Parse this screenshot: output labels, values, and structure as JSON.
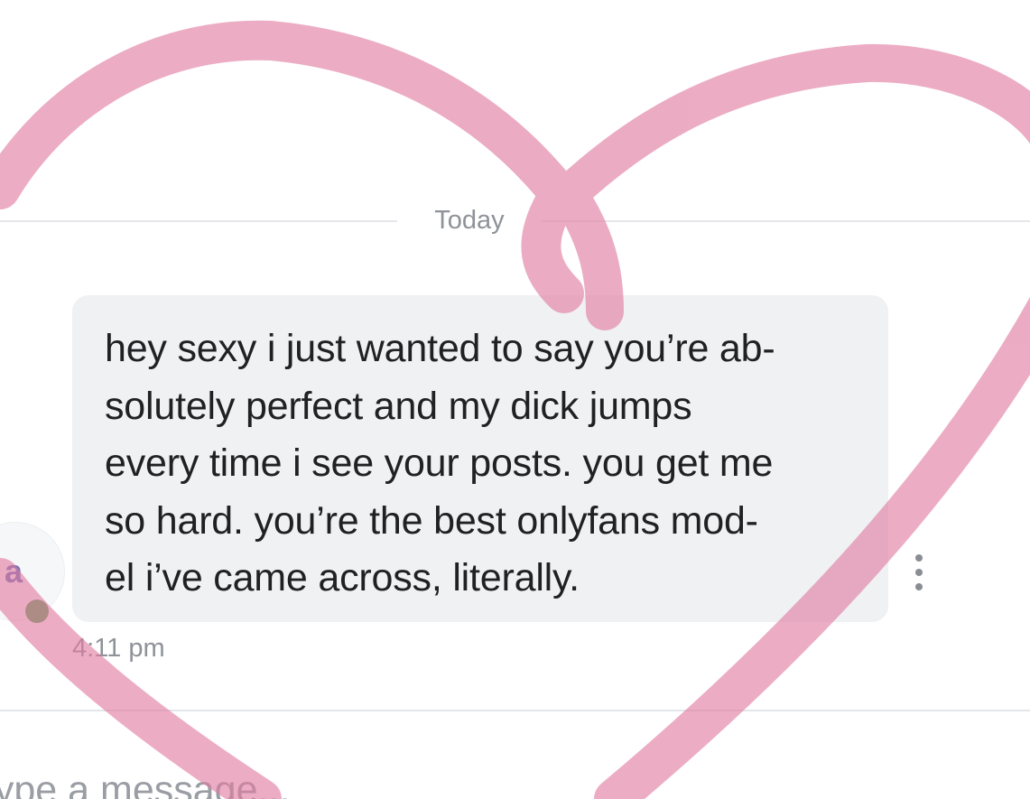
{
  "chat": {
    "date_divider": "Today",
    "avatar_initial": "a",
    "message": {
      "text": "hey sexy i just wanted to say you’re ab-\nsolutely perfect and my dick jumps\nevery time i see your posts. you get me\nso hard. you’re the best onlyfans mod-\nel i’ve came across, literally.",
      "time": "4:11 pm"
    },
    "composer": {
      "placeholder": "Type a message..."
    }
  },
  "overlay": {
    "shape": "heart",
    "color": "#e07aa0"
  },
  "colors": {
    "bubble": "#f0f1f3",
    "online_status": "#5aa85a",
    "avatar_initial": "#6c72b8"
  },
  "icons": {
    "more": "more-vertical-icon"
  }
}
